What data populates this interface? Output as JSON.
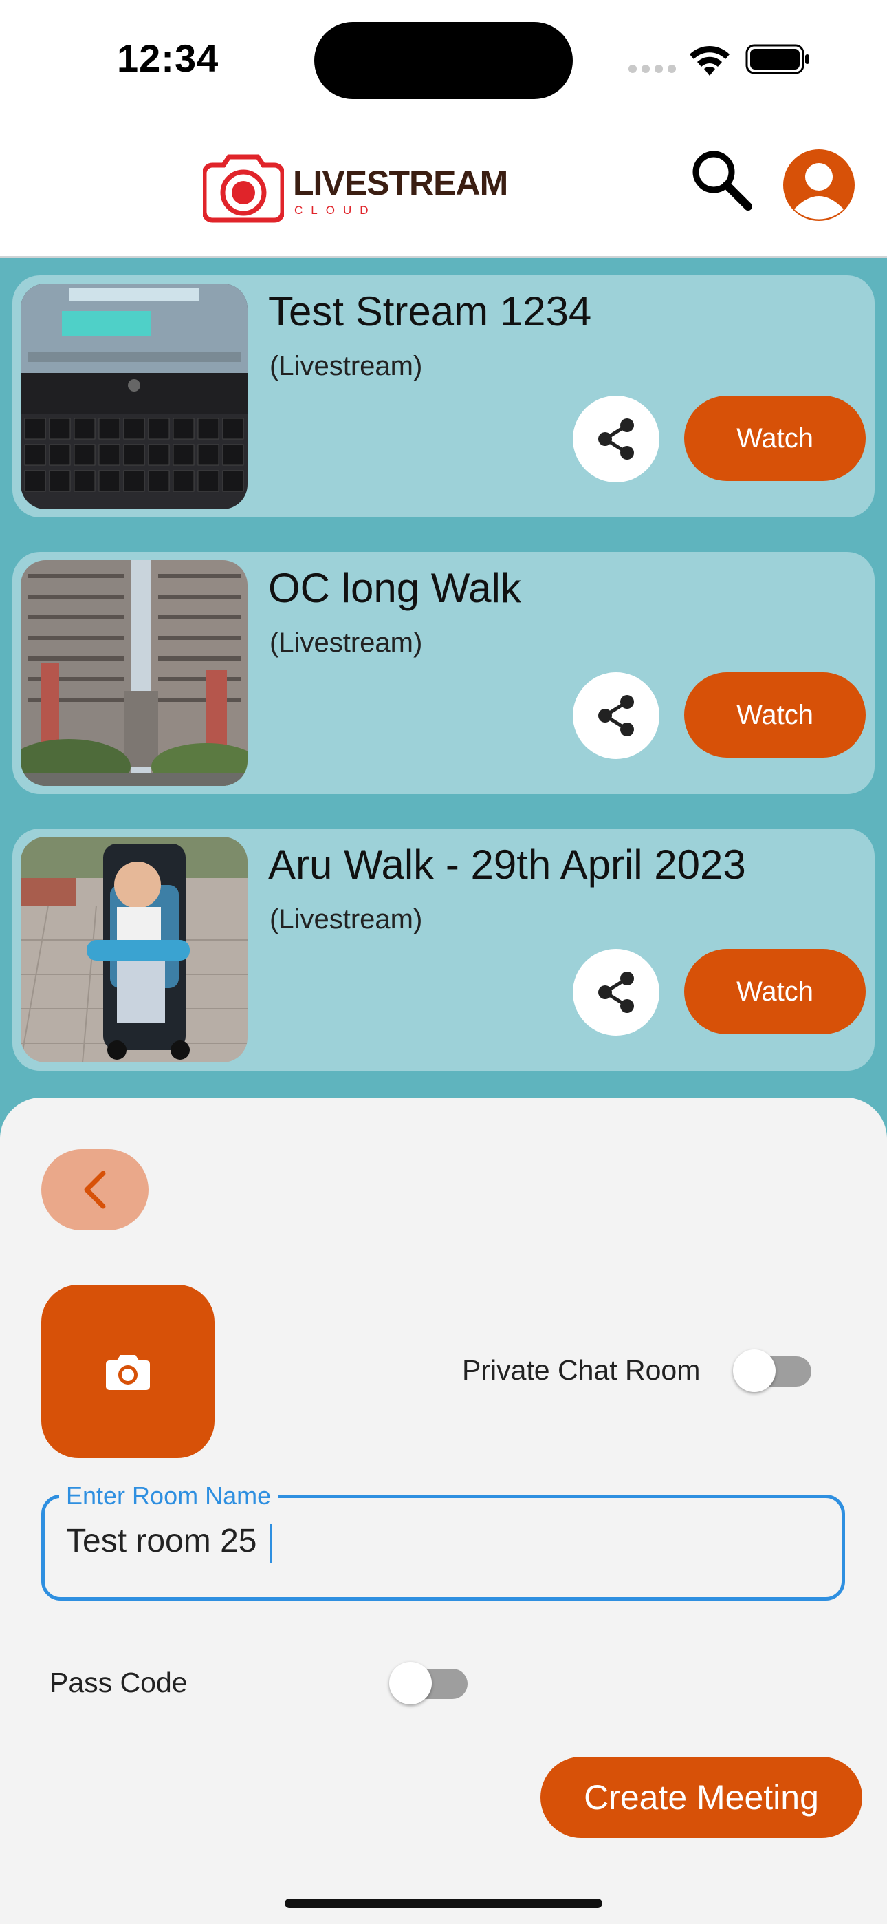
{
  "status_bar": {
    "time": "12:34"
  },
  "header": {
    "logo_title": "LIVESTREAM",
    "logo_subtitle": "CLOUD",
    "search_icon": "search-icon",
    "profile_icon": "user-avatar-icon"
  },
  "streams": [
    {
      "title": "Test Stream 1234",
      "subtitle": "(Livestream)",
      "watch_label": "Watch"
    },
    {
      "title": "OC long Walk",
      "subtitle": "(Livestream)",
      "watch_label": "Watch"
    },
    {
      "title": "Aru Walk - 29th April 2023",
      "subtitle": "(Livestream)",
      "watch_label": "Watch"
    }
  ],
  "sheet": {
    "private_chat_label": "Private Chat Room",
    "private_chat_on": false,
    "room_name_label": "Enter Room Name",
    "room_name_value": "Test room 25",
    "pass_code_label": "Pass Code",
    "pass_code_on": false,
    "create_label": "Create Meeting"
  },
  "colors": {
    "accent": "#d75108",
    "card_bg": "#9dd1d8",
    "list_bg": "#5fb4be",
    "input_focus": "#2e8fe0"
  }
}
